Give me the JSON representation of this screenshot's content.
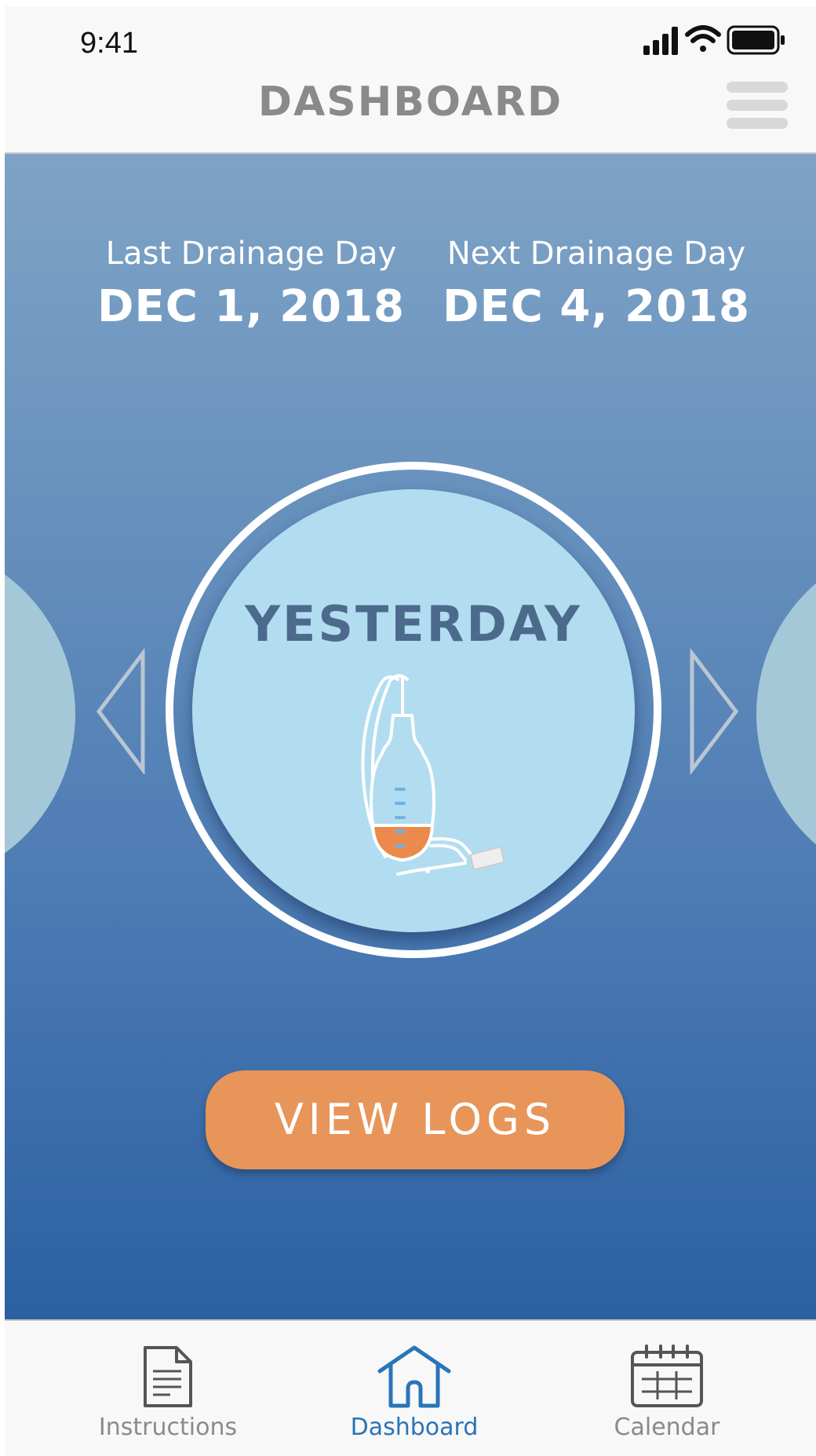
{
  "status_bar": {
    "time": "9:41",
    "icons": [
      "signal-icon",
      "wifi-icon",
      "battery-icon"
    ]
  },
  "nav": {
    "title": "DASHBOARD",
    "menu_icon": "hamburger-menu-icon"
  },
  "dates": {
    "last_label": "Last Drainage Day",
    "last_value": "DEC 1, 2018",
    "next_label": "Next Drainage Day",
    "next_value": "DEC 4, 2018"
  },
  "carousel": {
    "current_label": "YESTERDAY",
    "icon": "drainage-bag-icon",
    "prev_icon": "triangle-left-icon",
    "next_icon": "triangle-right-icon"
  },
  "actions": {
    "view_logs": "VIEW LOGS"
  },
  "tabs": [
    {
      "label": "Instructions",
      "icon": "document-icon",
      "active": false
    },
    {
      "label": "Dashboard",
      "icon": "home-icon",
      "active": true
    },
    {
      "label": "Calendar",
      "icon": "calendar-icon",
      "active": false
    }
  ],
  "colors": {
    "accent": "#e8955a",
    "active_tab": "#2a74b8",
    "circle_fill": "#b2ddf0",
    "gradient_top": "#7fa3c6",
    "gradient_bottom": "#2b60a3"
  }
}
